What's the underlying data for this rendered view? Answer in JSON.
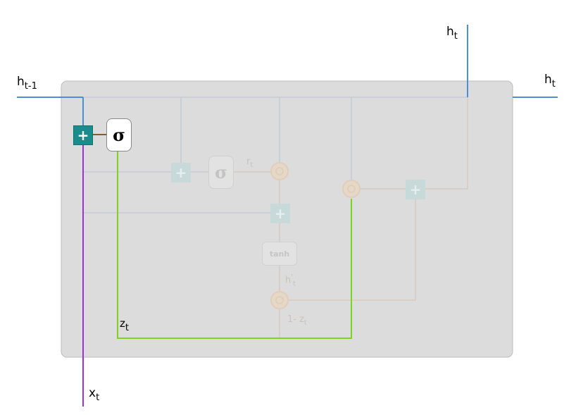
{
  "labels": {
    "h_prev_base": "h",
    "h_prev_sub": "t-1",
    "h_top_base": "h",
    "h_top_sub": "t",
    "h_right_base": "h",
    "h_right_sub": "t",
    "x_base": "x",
    "x_sub": "t",
    "z_base": "z",
    "z_sub": "t",
    "r_base": "r",
    "r_sub": "t",
    "htilde_base": "h",
    "htilde_prime": "'",
    "htilde_sub": "t",
    "one_minus_z_base": "1- z",
    "one_minus_z_sub": "t"
  },
  "symbols": {
    "sigma": "σ",
    "tanh": "tanh",
    "plus": "+"
  },
  "colors": {
    "hidden_line": "#4a90d9",
    "input_line": "#9b30e0",
    "gate_line": "#7ed321",
    "gate_connector": "#8b5a2b",
    "plus_active": "#1a8c8c",
    "panel_bg": "#dcdcdc",
    "panel_border": "#bdbdbd"
  }
}
